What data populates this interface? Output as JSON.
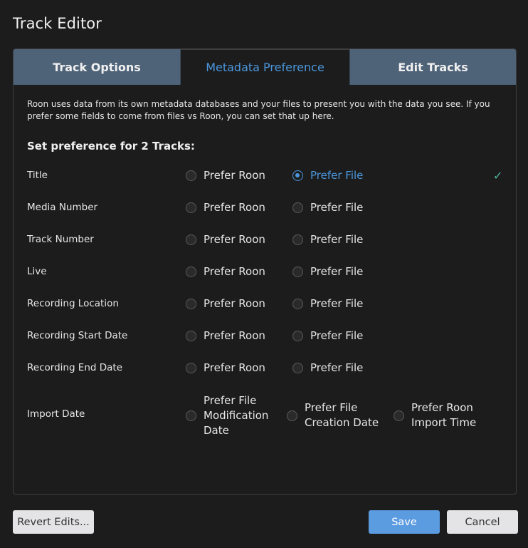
{
  "window": {
    "title": "Track Editor"
  },
  "tabs": [
    {
      "label": "Track Options"
    },
    {
      "label": "Metadata Preference"
    },
    {
      "label": "Edit Tracks"
    }
  ],
  "active_tab": "Metadata Preference",
  "description": "Roon uses data from its own metadata databases and your files to present you with the data you see. If you prefer some fields to come from files vs Roon, you can set that up here.",
  "heading": "Set preference for 2 Tracks:",
  "options": {
    "roon": "Prefer Roon",
    "file": "Prefer File"
  },
  "rows": [
    {
      "label": "Title",
      "selected": "file",
      "modified": true
    },
    {
      "label": "Media Number",
      "selected": ""
    },
    {
      "label": "Track Number",
      "selected": ""
    },
    {
      "label": "Live",
      "selected": ""
    },
    {
      "label": "Recording Location",
      "selected": ""
    },
    {
      "label": "Recording Start Date",
      "selected": ""
    },
    {
      "label": "Recording End Date",
      "selected": ""
    }
  ],
  "import_date": {
    "label": "Import Date",
    "options": [
      "Prefer File Modification Date",
      "Prefer File Creation Date",
      "Prefer Roon Import Time"
    ],
    "option_lines": [
      [
        "Prefer File",
        "Modification",
        "Date"
      ],
      [
        "Prefer File",
        "Creation Date"
      ],
      [
        "Prefer Roon",
        "Import Time"
      ]
    ]
  },
  "check_icon": "✓",
  "buttons": {
    "revert": "Revert Edits...",
    "save": "Save",
    "cancel": "Cancel"
  },
  "colors": {
    "accent": "#4b98dd",
    "tab_bg": "#4f6378",
    "check": "#4fb6a0",
    "save": "#5b9be0"
  }
}
